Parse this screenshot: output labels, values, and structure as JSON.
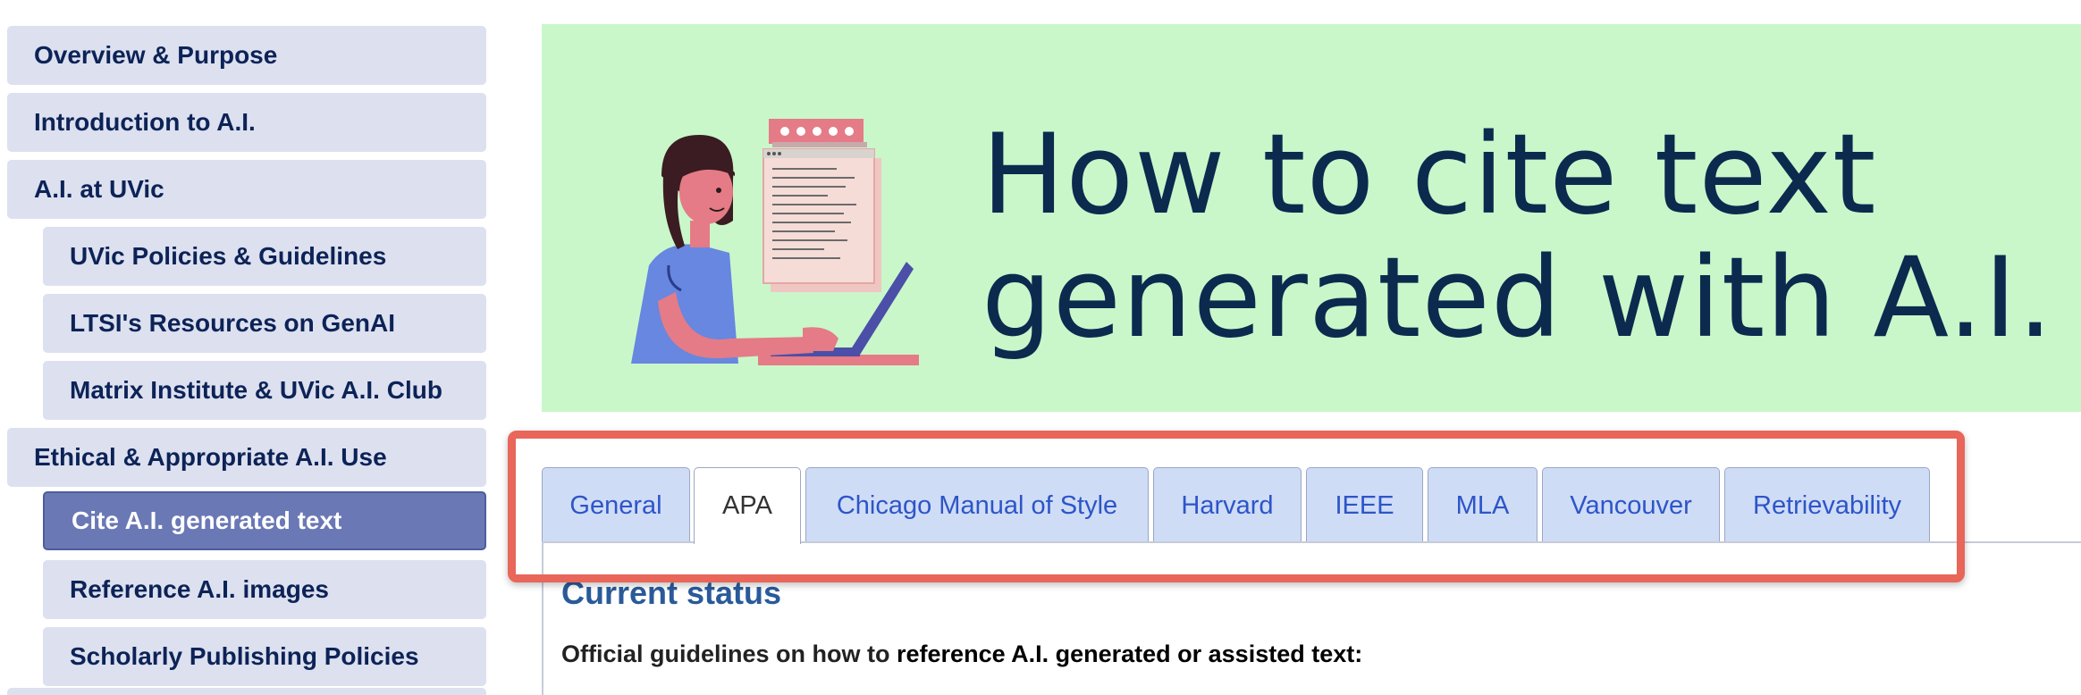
{
  "sidebar": {
    "items": [
      {
        "label": "Overview & Purpose"
      },
      {
        "label": "Introduction to A.I."
      },
      {
        "label": "A.I. at UVic"
      },
      {
        "label": "UVic Policies & Guidelines"
      },
      {
        "label": "LTSI's Resources on GenAI"
      },
      {
        "label": "Matrix Institute & UVic A.I. Club"
      },
      {
        "label": "Ethical & Appropriate A.I. Use"
      },
      {
        "label": "Cite A.I. generated text"
      },
      {
        "label": "Reference A.I. images"
      },
      {
        "label": "Scholarly Publishing Policies"
      }
    ]
  },
  "banner": {
    "title_line1": "How to cite text",
    "title_line2": "generated with A.I.",
    "background_color": "#c9f7ca"
  },
  "tabs": [
    {
      "label": "General"
    },
    {
      "label": "APA"
    },
    {
      "label": "Chicago Manual of Style"
    },
    {
      "label": "Harvard"
    },
    {
      "label": "IEEE"
    },
    {
      "label": "MLA"
    },
    {
      "label": "Vancouver"
    },
    {
      "label": "Retrievability"
    }
  ],
  "content": {
    "heading": "Current status",
    "guidelines_prefix": "Official guidelines on how to ",
    "guidelines_emphasis": "reference A.I. generated or assisted text:"
  },
  "colors": {
    "nav_bg": "#dde0ef",
    "nav_active_bg": "#6a78b5",
    "nav_text": "#0c2357",
    "tab_bg": "#cfdcf6",
    "tab_text": "#2d55c8",
    "highlight": "#e8665a"
  }
}
